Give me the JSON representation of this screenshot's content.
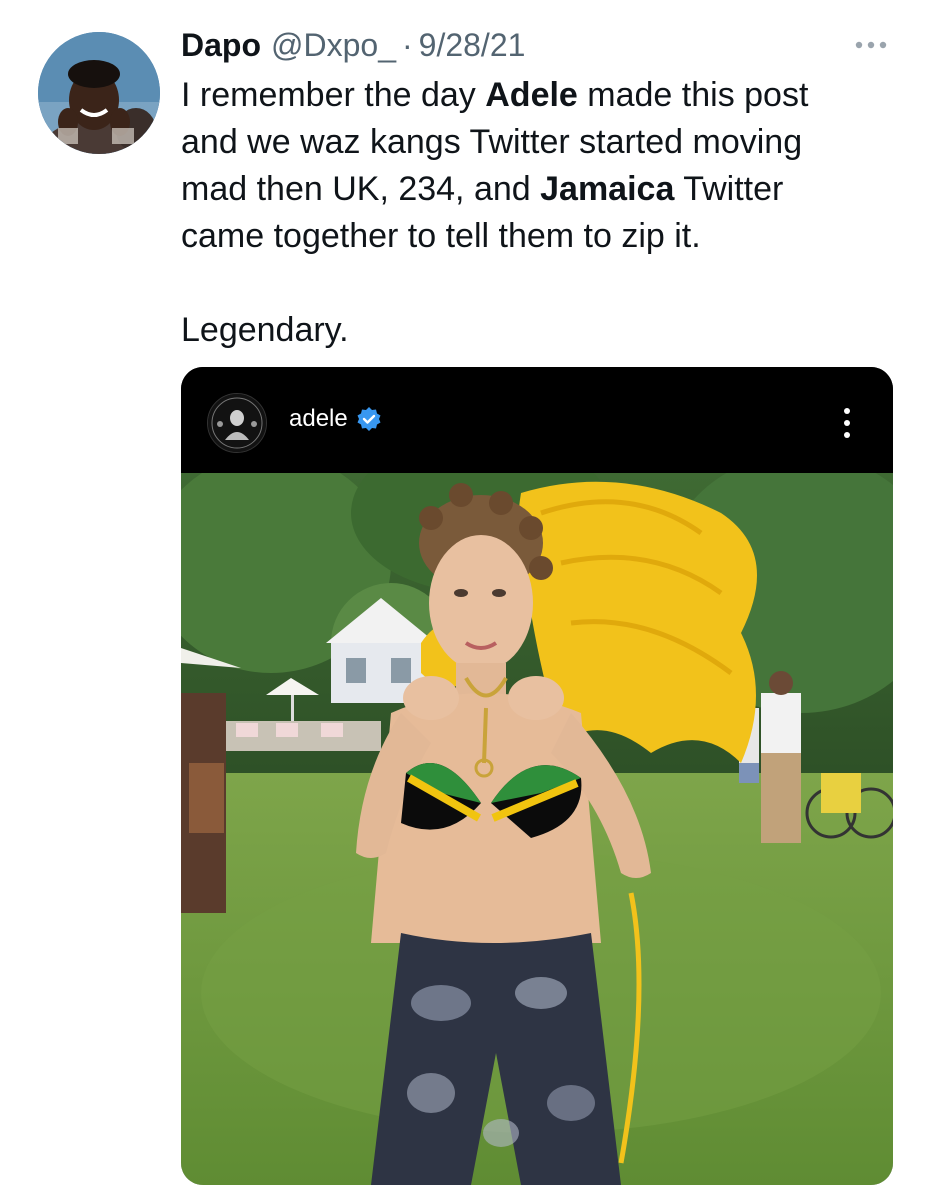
{
  "tweet": {
    "author_name": "Dapo",
    "handle": "@Dxpo_",
    "separator": "·",
    "date": "9/28/21",
    "more_icon": "more-horizontal-icon",
    "text": {
      "line1_a": "I remember the day ",
      "line1_b": "Adele",
      "line1_c": " made this post",
      "line2": "and we waz kangs Twitter started moving",
      "line3_a": "mad then UK, 234, and ",
      "line3_b": "Jamaica",
      "line3_c": " Twitter",
      "line4": "came together to tell them to zip it.",
      "line5": "Legendary."
    }
  },
  "media": {
    "instagram_username": "adele",
    "verified_icon": "verified-badge-icon",
    "options_icon": "more-vertical-icon",
    "accent_verified": "#3897f0"
  },
  "colors": {
    "text_primary": "#0f1419",
    "text_secondary": "#536471",
    "grass": "#6f9a3a",
    "feathers": "#f2c21b"
  }
}
